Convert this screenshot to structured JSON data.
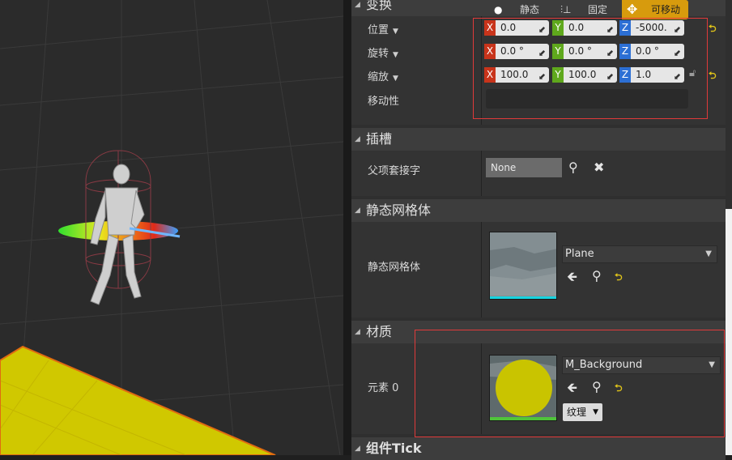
{
  "transform": {
    "title": "变换",
    "location": {
      "label": "位置",
      "x": "0.0",
      "y": "0.0",
      "z": "-5000."
    },
    "rotation": {
      "label": "旋转",
      "x": "0.0 °",
      "y": "0.0 °",
      "z": "0.0 °"
    },
    "scale": {
      "label": "缩放",
      "x": "100.0",
      "y": "100.0",
      "z": "1.0"
    },
    "mobility": {
      "label": "移动性",
      "static": "静态",
      "stationary": "固定",
      "movable": "可移动",
      "selected": "可移动"
    },
    "axis": {
      "x": "X",
      "y": "Y",
      "z": "Z"
    }
  },
  "sockets": {
    "title": "插槽",
    "parent_socket_label": "父项套接字",
    "parent_socket_value": "None"
  },
  "static_mesh": {
    "title": "静态网格体",
    "label": "静态网格体",
    "value": "Plane"
  },
  "materials": {
    "title": "材质",
    "element_label": "元素 0",
    "value": "M_Background",
    "texture_button": "纹理"
  },
  "component_tick": {
    "title": "组件Tick"
  },
  "colors": {
    "accent": "#d79b0d",
    "axis_x": "#c8341b",
    "axis_y": "#5fa81c",
    "axis_z": "#2c6fd4",
    "highlight": "#e03a3a"
  }
}
